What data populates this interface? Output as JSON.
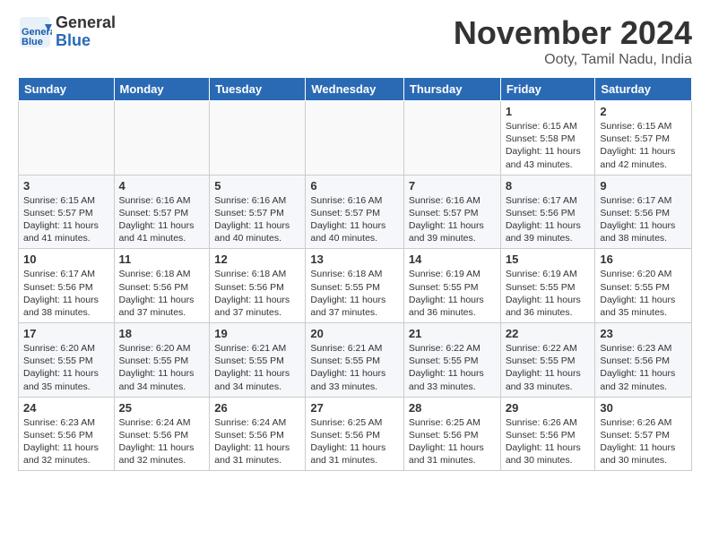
{
  "header": {
    "logo_line1": "General",
    "logo_line2": "Blue",
    "month": "November 2024",
    "location": "Ooty, Tamil Nadu, India"
  },
  "days_of_week": [
    "Sunday",
    "Monday",
    "Tuesday",
    "Wednesday",
    "Thursday",
    "Friday",
    "Saturday"
  ],
  "weeks": [
    [
      {
        "day": "",
        "empty": true
      },
      {
        "day": "",
        "empty": true
      },
      {
        "day": "",
        "empty": true
      },
      {
        "day": "",
        "empty": true
      },
      {
        "day": "",
        "empty": true
      },
      {
        "day": "1",
        "sunrise": "6:15 AM",
        "sunset": "5:58 PM",
        "daylight": "11 hours and 43 minutes."
      },
      {
        "day": "2",
        "sunrise": "6:15 AM",
        "sunset": "5:57 PM",
        "daylight": "11 hours and 42 minutes."
      }
    ],
    [
      {
        "day": "3",
        "sunrise": "6:15 AM",
        "sunset": "5:57 PM",
        "daylight": "11 hours and 41 minutes."
      },
      {
        "day": "4",
        "sunrise": "6:16 AM",
        "sunset": "5:57 PM",
        "daylight": "11 hours and 41 minutes."
      },
      {
        "day": "5",
        "sunrise": "6:16 AM",
        "sunset": "5:57 PM",
        "daylight": "11 hours and 40 minutes."
      },
      {
        "day": "6",
        "sunrise": "6:16 AM",
        "sunset": "5:57 PM",
        "daylight": "11 hours and 40 minutes."
      },
      {
        "day": "7",
        "sunrise": "6:16 AM",
        "sunset": "5:57 PM",
        "daylight": "11 hours and 39 minutes."
      },
      {
        "day": "8",
        "sunrise": "6:17 AM",
        "sunset": "5:56 PM",
        "daylight": "11 hours and 39 minutes."
      },
      {
        "day": "9",
        "sunrise": "6:17 AM",
        "sunset": "5:56 PM",
        "daylight": "11 hours and 38 minutes."
      }
    ],
    [
      {
        "day": "10",
        "sunrise": "6:17 AM",
        "sunset": "5:56 PM",
        "daylight": "11 hours and 38 minutes."
      },
      {
        "day": "11",
        "sunrise": "6:18 AM",
        "sunset": "5:56 PM",
        "daylight": "11 hours and 37 minutes."
      },
      {
        "day": "12",
        "sunrise": "6:18 AM",
        "sunset": "5:56 PM",
        "daylight": "11 hours and 37 minutes."
      },
      {
        "day": "13",
        "sunrise": "6:18 AM",
        "sunset": "5:55 PM",
        "daylight": "11 hours and 37 minutes."
      },
      {
        "day": "14",
        "sunrise": "6:19 AM",
        "sunset": "5:55 PM",
        "daylight": "11 hours and 36 minutes."
      },
      {
        "day": "15",
        "sunrise": "6:19 AM",
        "sunset": "5:55 PM",
        "daylight": "11 hours and 36 minutes."
      },
      {
        "day": "16",
        "sunrise": "6:20 AM",
        "sunset": "5:55 PM",
        "daylight": "11 hours and 35 minutes."
      }
    ],
    [
      {
        "day": "17",
        "sunrise": "6:20 AM",
        "sunset": "5:55 PM",
        "daylight": "11 hours and 35 minutes."
      },
      {
        "day": "18",
        "sunrise": "6:20 AM",
        "sunset": "5:55 PM",
        "daylight": "11 hours and 34 minutes."
      },
      {
        "day": "19",
        "sunrise": "6:21 AM",
        "sunset": "5:55 PM",
        "daylight": "11 hours and 34 minutes."
      },
      {
        "day": "20",
        "sunrise": "6:21 AM",
        "sunset": "5:55 PM",
        "daylight": "11 hours and 33 minutes."
      },
      {
        "day": "21",
        "sunrise": "6:22 AM",
        "sunset": "5:55 PM",
        "daylight": "11 hours and 33 minutes."
      },
      {
        "day": "22",
        "sunrise": "6:22 AM",
        "sunset": "5:55 PM",
        "daylight": "11 hours and 33 minutes."
      },
      {
        "day": "23",
        "sunrise": "6:23 AM",
        "sunset": "5:56 PM",
        "daylight": "11 hours and 32 minutes."
      }
    ],
    [
      {
        "day": "24",
        "sunrise": "6:23 AM",
        "sunset": "5:56 PM",
        "daylight": "11 hours and 32 minutes."
      },
      {
        "day": "25",
        "sunrise": "6:24 AM",
        "sunset": "5:56 PM",
        "daylight": "11 hours and 32 minutes."
      },
      {
        "day": "26",
        "sunrise": "6:24 AM",
        "sunset": "5:56 PM",
        "daylight": "11 hours and 31 minutes."
      },
      {
        "day": "27",
        "sunrise": "6:25 AM",
        "sunset": "5:56 PM",
        "daylight": "11 hours and 31 minutes."
      },
      {
        "day": "28",
        "sunrise": "6:25 AM",
        "sunset": "5:56 PM",
        "daylight": "11 hours and 31 minutes."
      },
      {
        "day": "29",
        "sunrise": "6:26 AM",
        "sunset": "5:56 PM",
        "daylight": "11 hours and 30 minutes."
      },
      {
        "day": "30",
        "sunrise": "6:26 AM",
        "sunset": "5:57 PM",
        "daylight": "11 hours and 30 minutes."
      }
    ]
  ]
}
